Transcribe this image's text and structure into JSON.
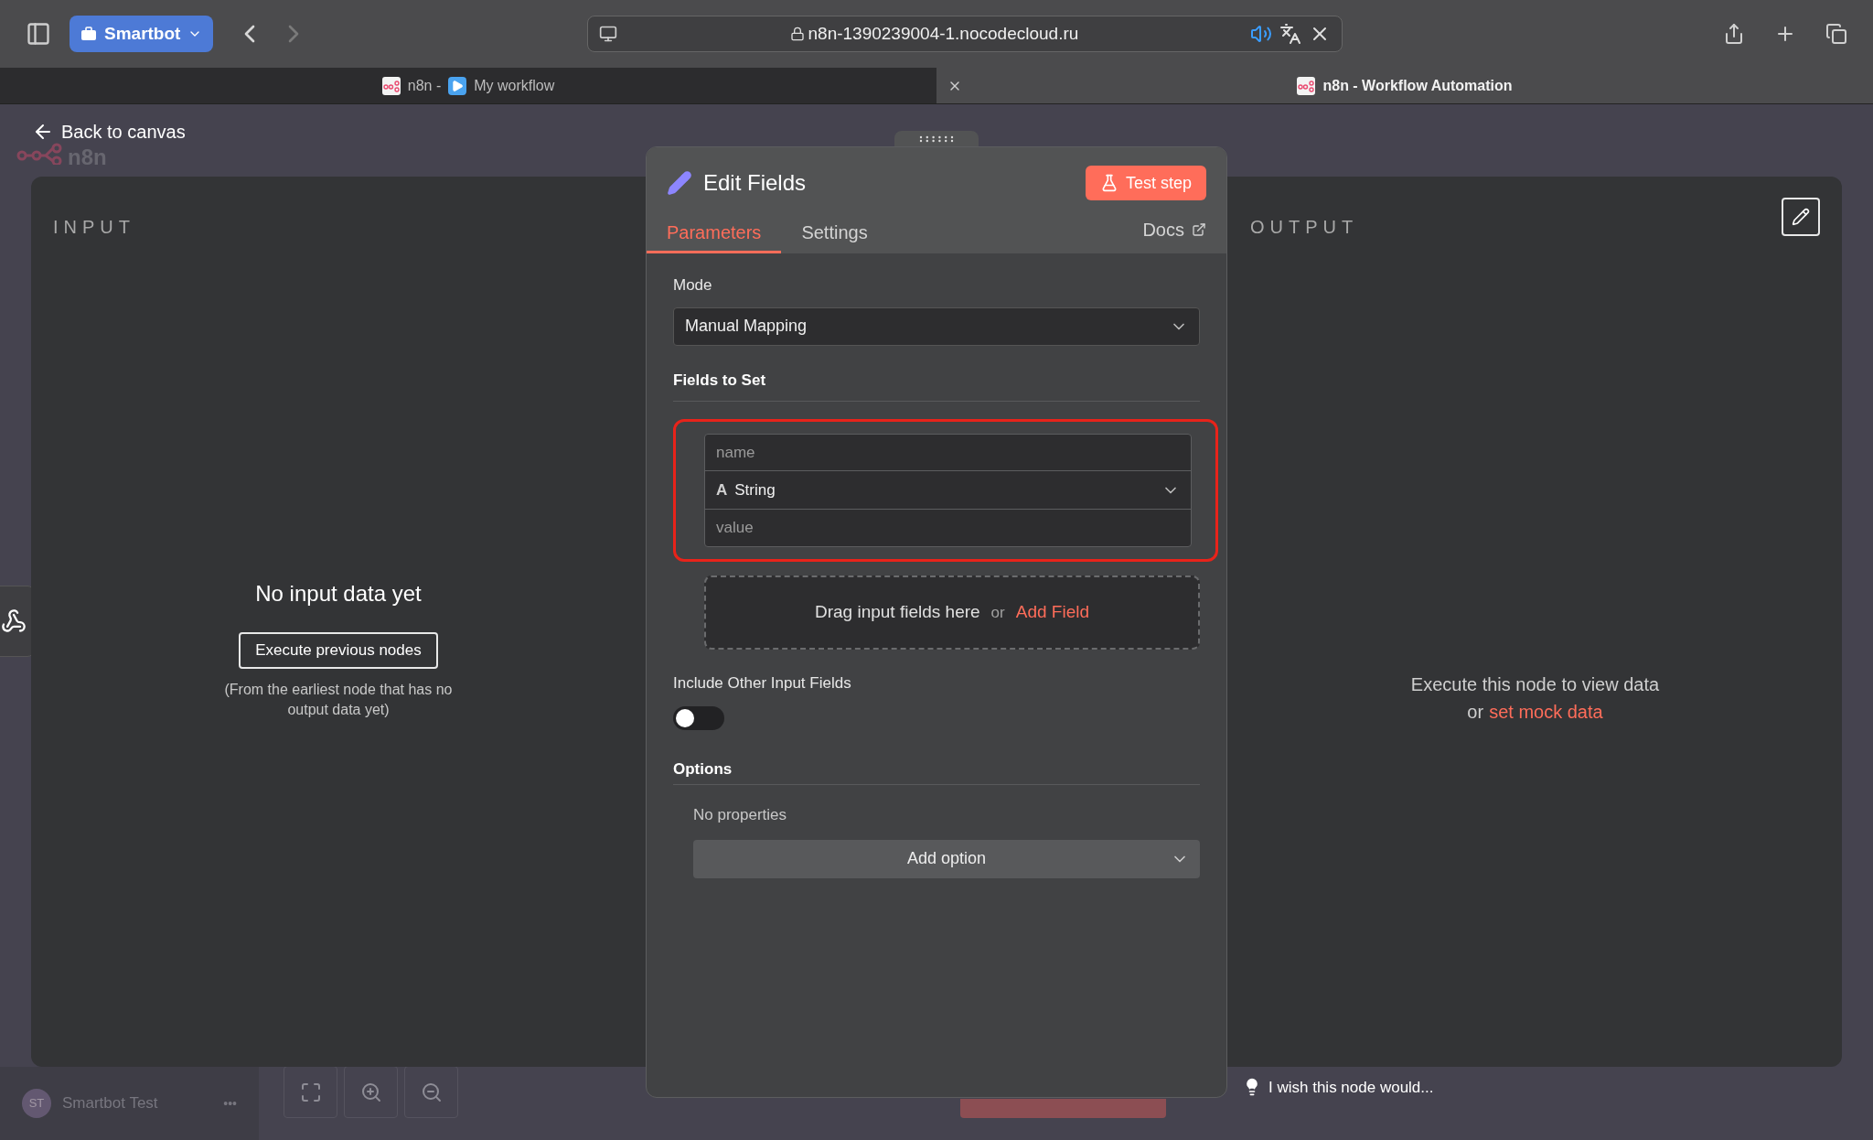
{
  "browser": {
    "profile": "Smartbot",
    "url": "n8n-1390239004-1.nocodecloud.ru",
    "tabs": [
      {
        "title_parts": [
          "n8n -",
          "My workflow"
        ],
        "selected": false
      },
      {
        "title_parts": [
          "n8n - Workflow Automation"
        ],
        "selected": true
      }
    ]
  },
  "canvas": {
    "logo_text": "n8n",
    "back_link": "Back to canvas",
    "user": {
      "initials": "ST",
      "name": "Smartbot Test",
      "more": "•••"
    },
    "feedback": "I wish this node would..."
  },
  "input_panel": {
    "label": "INPUT",
    "title": "No input data yet",
    "button": "Execute previous nodes",
    "hint": "(From the earliest node that has no output data yet)"
  },
  "output_panel": {
    "label": "OUTPUT",
    "message": "Execute this node to view data",
    "alt_prefix": "or",
    "alt_link": "set mock data"
  },
  "node": {
    "title": "Edit Fields",
    "test_button": "Test step",
    "tabs": [
      {
        "label": "Parameters",
        "selected": true
      },
      {
        "label": "Settings",
        "selected": false
      }
    ],
    "docs": "Docs",
    "mode": {
      "label": "Mode",
      "value": "Manual Mapping"
    },
    "fields_section": "Fields to Set",
    "field": {
      "name_placeholder": "name",
      "type_icon": "A",
      "type": "String",
      "value_placeholder": "value",
      "highlighted": true
    },
    "drop_zone": {
      "text": "Drag input fields here",
      "or": "or",
      "link": "Add Field"
    },
    "include_other": {
      "label": "Include Other Input Fields",
      "on": false
    },
    "options": {
      "label": "Options",
      "empty": "No properties",
      "add": "Add option"
    }
  }
}
